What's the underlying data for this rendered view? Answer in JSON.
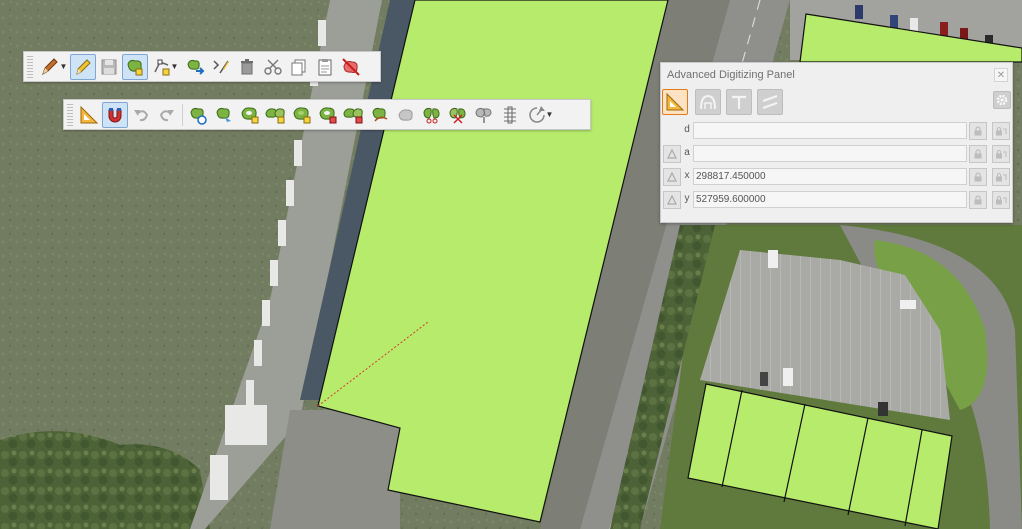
{
  "toolbar_digitizing": {
    "buttons": [
      {
        "icon": "pencil-dropdown-icon",
        "active": false
      },
      {
        "icon": "toggle-editing-pencil-icon",
        "active": true
      },
      {
        "icon": "save-edits-icon",
        "active": false
      },
      {
        "icon": "add-polygon-feature-icon",
        "active": true
      },
      {
        "icon": "vertex-tool-icon",
        "active": false
      },
      {
        "icon": "move-feature-icon",
        "active": false
      },
      {
        "icon": "modify-attributes-icon",
        "active": false
      },
      {
        "icon": "delete-selected-icon",
        "active": false
      },
      {
        "icon": "cut-features-icon",
        "active": false
      },
      {
        "icon": "copy-features-icon",
        "active": false
      },
      {
        "icon": "paste-features-icon",
        "active": false
      },
      {
        "icon": "digitize-with-segment-icon",
        "active": false
      }
    ]
  },
  "toolbar_advanced": {
    "buttons": [
      {
        "icon": "advanced-digitizing-icon",
        "active": false
      },
      {
        "icon": "snapping-magnet-icon",
        "active": true
      },
      {
        "icon": "undo-icon",
        "active": false
      },
      {
        "icon": "redo-icon",
        "active": false
      },
      {
        "icon": "rotate-feature-icon",
        "active": false
      },
      {
        "icon": "simplify-feature-icon",
        "active": false
      },
      {
        "icon": "add-ring-icon",
        "active": false
      },
      {
        "icon": "add-part-icon",
        "active": false
      },
      {
        "icon": "fill-ring-icon",
        "active": false
      },
      {
        "icon": "delete-ring-icon",
        "active": false
      },
      {
        "icon": "delete-part-icon",
        "active": false
      },
      {
        "icon": "reshape-features-icon",
        "active": false
      },
      {
        "icon": "offset-curve-icon",
        "active": false
      },
      {
        "icon": "split-features-icon",
        "active": false
      },
      {
        "icon": "split-parts-icon",
        "active": false
      },
      {
        "icon": "merge-attributes-icon",
        "active": false
      },
      {
        "icon": "merge-features-icon",
        "active": false
      },
      {
        "icon": "rotate-point-symbols-icon",
        "active": false
      }
    ]
  },
  "panel": {
    "title": "Advanced Digitizing Panel",
    "close_icon": "close-icon",
    "rows": [
      {
        "label": "d",
        "value": ""
      },
      {
        "label": "a",
        "value": ""
      },
      {
        "label": "x",
        "value": "298817.450000"
      },
      {
        "label": "y",
        "value": "527959.600000"
      }
    ]
  },
  "colors": {
    "polygon_fill": "#b6eb6c",
    "polygon_stroke": "#111111",
    "active_button": "#cfe3f6",
    "panel_active": "#e07b18",
    "sketch_line": "#d73a2a"
  }
}
